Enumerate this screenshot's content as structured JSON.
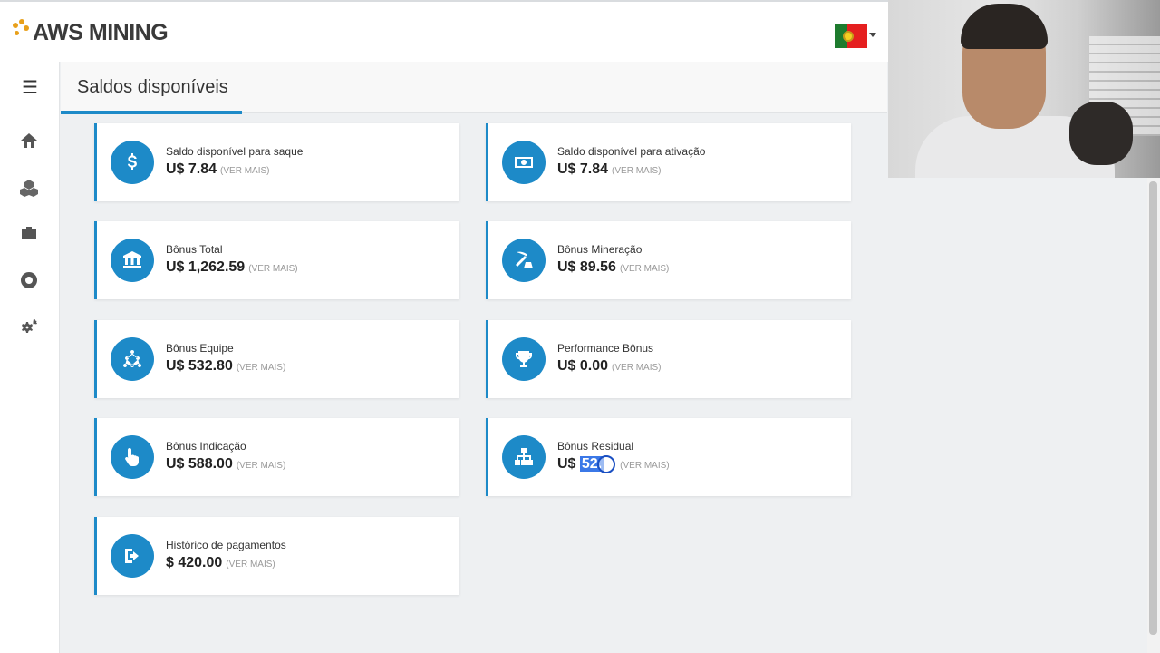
{
  "brand": {
    "name": "AWS MINING"
  },
  "header": {
    "flag_name": "portugal-flag"
  },
  "page": {
    "title": "Saldos disponíveis"
  },
  "sidebar": {
    "items": [
      {
        "icon": "home-icon"
      },
      {
        "icon": "cubes-icon"
      },
      {
        "icon": "briefcase-icon"
      },
      {
        "icon": "lifebuoy-icon"
      },
      {
        "icon": "gears-icon"
      }
    ]
  },
  "cards": [
    {
      "title": "Saldo disponível para saque",
      "value": "U$ 7.84",
      "more": "(VER MAIS)",
      "icon": "dollar-icon"
    },
    {
      "title": "Saldo disponível para ativação",
      "value": "U$ 7.84",
      "more": "(VER MAIS)",
      "icon": "money-bill-icon"
    },
    {
      "title": "Bônus Total",
      "value": "U$ 1,262.59",
      "more": "(VER MAIS)",
      "icon": "bank-icon"
    },
    {
      "title": "Bônus Mineração",
      "value": "U$ 89.56",
      "more": "(VER MAIS)",
      "icon": "pickaxe-icon"
    },
    {
      "title": "Bônus Equipe",
      "value": "U$ 532.80",
      "more": "(VER MAIS)",
      "icon": "network-icon"
    },
    {
      "title": "Performance Bônus",
      "value": "U$ 0.00",
      "more": "(VER MAIS)",
      "icon": "trophy-icon"
    },
    {
      "title": "Bônus Indicação",
      "value": "U$ 588.00",
      "more": "(VER MAIS)",
      "icon": "pointer-hand-icon"
    },
    {
      "title": "Bônus Residual",
      "value_prefix": "U$",
      "value_selected": "52.",
      "more": "(VER MAIS)",
      "icon": "sitemap-icon"
    },
    {
      "title": "Histórico de pagamentos",
      "value": "$ 420.00",
      "more": "(VER MAIS)",
      "icon": "sign-out-icon"
    }
  ],
  "colors": {
    "accent": "#1d8ac8",
    "selection": "#3b78e7",
    "logo_dots": "#e8a01b"
  }
}
